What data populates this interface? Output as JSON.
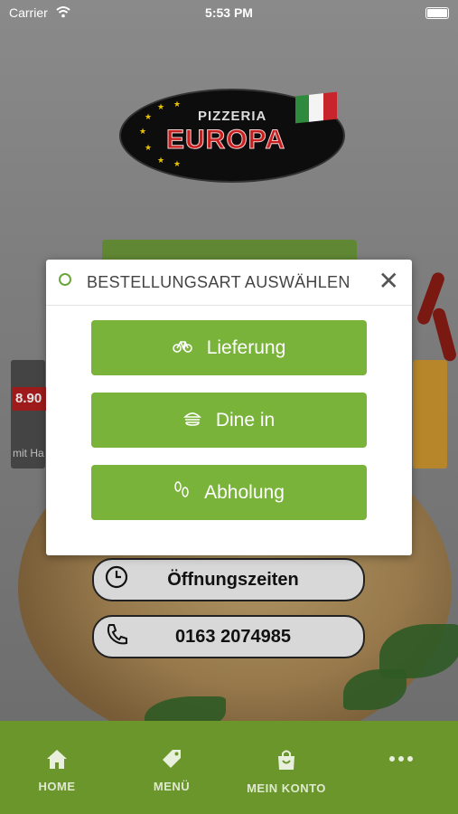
{
  "status_bar": {
    "carrier": "Carrier",
    "time": "5:53 PM"
  },
  "logo": {
    "line1": "PIZZERIA",
    "line2": "EUROPA"
  },
  "background": {
    "price": "8.90",
    "hint": "mit Ha"
  },
  "modal": {
    "title": "BESTELLUNGSART AUSWÄHLEN",
    "close": "✕",
    "options": [
      {
        "label": "Lieferung",
        "icon": "bicycle-icon"
      },
      {
        "label": "Dine in",
        "icon": "burger-icon"
      },
      {
        "label": "Abholung",
        "icon": "footsteps-icon"
      }
    ]
  },
  "info_buttons": [
    {
      "label": "Öffnungszeiten",
      "icon": "clock-icon"
    },
    {
      "label": "0163 2074985",
      "icon": "phone-icon"
    }
  ],
  "tabbar": [
    {
      "label": "HOME",
      "icon": "home-icon"
    },
    {
      "label": "MENÜ",
      "icon": "tag-icon"
    },
    {
      "label": "MEIN KONTO",
      "icon": "shopping-bag-icon"
    },
    {
      "label": "",
      "icon": "more-icon"
    }
  ],
  "colors": {
    "primary_green": "#79b33a",
    "tabbar_green": "#6a962b"
  }
}
